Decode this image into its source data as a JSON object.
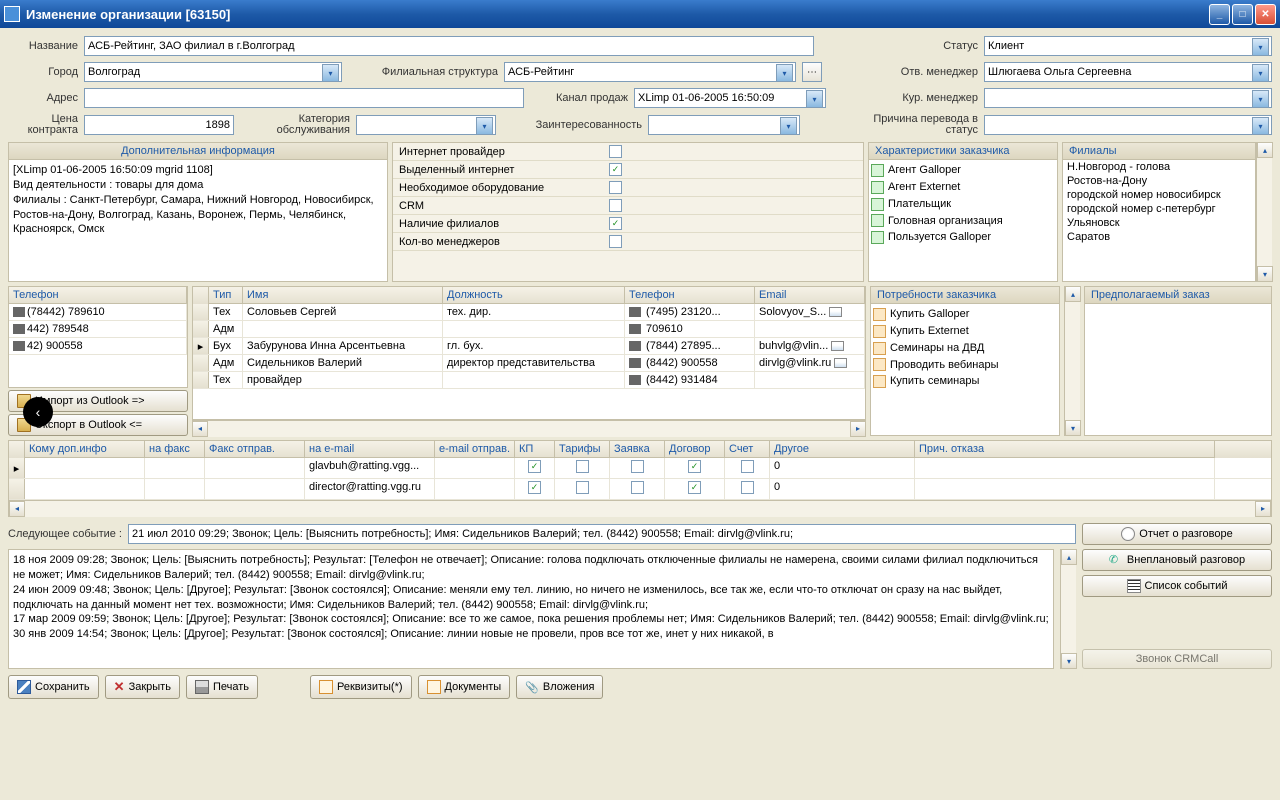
{
  "window": {
    "title": "Изменение организации [63150]"
  },
  "labels": {
    "name": "Название",
    "city": "Город",
    "branch_struct": "Филиальная структура",
    "status": "Статус",
    "resp_mgr": "Отв. менеджер",
    "address": "Адрес",
    "sales_channel": "Канал продаж",
    "cur_mgr": "Кур. менеджер",
    "contract_price": "Цена контракта",
    "service_cat": "Категория обслуживания",
    "interest": "Заинтересованность",
    "reason_status": "Причина перевода в статус"
  },
  "fields": {
    "name": "АСБ-Рейтинг, ЗАО филиал в г.Волгоград",
    "city": "Волгоград",
    "branch_struct": "АСБ-Рейтинг",
    "status": "Клиент",
    "resp_mgr": "Шлюгаева Ольга Сергеевна",
    "address": "",
    "sales_channel": "XLimp 01-06-2005 16:50:09",
    "cur_mgr": "",
    "contract_price": "1898",
    "service_cat": "",
    "interest": "",
    "reason_status": ""
  },
  "addinfo": {
    "head": "Дополнительная информация",
    "body": "[XLimp 01-06-2005 16:50:09 mgrid 1108]\nВид деятельности : товары для дома\nФилиалы : Санкт-Петербург, Самара, Нижний Новгород, Новосибирск, Ростов-на-Дону, Волгоград, Казань, Воронеж, Пермь, Челябинск, Красноярск, Омск"
  },
  "props": {
    "items": [
      {
        "label": "Интернет провайдер",
        "checked": false
      },
      {
        "label": "Выделенный интернет",
        "checked": true
      },
      {
        "label": "Необходимое оборудование",
        "checked": false
      },
      {
        "label": "CRM",
        "checked": false
      },
      {
        "label": "Наличие филиалов",
        "checked": true
      },
      {
        "label": "Кол-во менеджеров",
        "checked": false
      }
    ]
  },
  "char": {
    "head": "Характеристики заказчика",
    "items": [
      "Агент Galloper",
      "Агент Externet",
      "Плательщик",
      "Головная организация",
      "Пользуется Galloper"
    ]
  },
  "branches": {
    "head": "Филиалы",
    "items": [
      "Н.Новгород - голова",
      "Ростов-на-Дону",
      "городской номер новосибирск",
      "городской номер с-петербург",
      "Ульяновск",
      "Саратов"
    ]
  },
  "needs": {
    "head": "Потребности заказчика",
    "items": [
      "Купить Galloper",
      "Купить Externet",
      "Семинары на ДВД",
      "Проводить вебинары",
      "Купить семинары"
    ]
  },
  "proposed": {
    "head": "Предполагаемый заказ"
  },
  "phones": {
    "head": "Телефон",
    "items": [
      "(78442) 789610",
      "442) 789548",
      "42) 900558"
    ],
    "import_btn": "Импорт из Outlook =>",
    "export_btn": "Экспорт в Outlook <="
  },
  "contacts": {
    "cols": {
      "type": "Тип",
      "name": "Имя",
      "pos": "Должность",
      "tel": "Телефон",
      "email": "Email"
    },
    "rows": [
      {
        "type": "Тех",
        "name": "Соловьев Сергей",
        "pos": "тех. дир.",
        "tel": "(7495) 23120...",
        "email": "Solovyov_S..."
      },
      {
        "type": "Адм",
        "name": "",
        "pos": "",
        "tel": "709610",
        "email": ""
      },
      {
        "type": "Бух",
        "name": "Забурунова Инна Арсентьевна",
        "pos": "гл. бух.",
        "tel": "(7844) 27895...",
        "email": "buhvlg@vlin...",
        "current": true
      },
      {
        "type": "Адм",
        "name": "Сидельников Валерий",
        "pos": "директор представительства",
        "tel": "(8442) 900558",
        "email": "dirvlg@vlink.ru"
      },
      {
        "type": "Тех",
        "name": "провайдер",
        "pos": "",
        "tel": "(8442) 931484",
        "email": ""
      }
    ]
  },
  "docgrid": {
    "cols": [
      "Кому доп.инфо",
      "на факс",
      "Факс отправ.",
      "на e-mail",
      "e-mail отправ.",
      "КП",
      "Тарифы",
      "Заявка",
      "Договор",
      "Счет",
      "Другое",
      "Прич. отказа"
    ],
    "rows": [
      {
        "email": "glavbuh@ratting.vgg...",
        "kp": true,
        "dogovor": true,
        "other": "0"
      },
      {
        "email": "director@ratting.vgg.ru",
        "kp": true,
        "dogovor": true,
        "other": "0"
      }
    ]
  },
  "nextevent": {
    "label": "Следующее событие :",
    "text": "21 июл 2010 09:29; Звонок; Цель: [Выяснить потребность]; Имя: Сидельников Валерий; тел. (8442) 900558; Email: dirvlg@vlink.ru;",
    "report_btn": "Отчет о разговоре"
  },
  "history": "18 ноя 2009 09:28; Звонок; Цель: [Выяснить потребность]; Результат: [Телефон не отвечает]; Описание: голова подключать отключенные филиалы не намерена, своими силами филиал подключиться не может; Имя: Сидельников Валерий; тел. (8442) 900558; Email: dirvlg@vlink.ru;\n24 июн 2009 09:48; Звонок; Цель: [Другое]; Результат: [Звонок состоялся]; Описание: меняли ему тел. линию, но ничего не изменилось, все так же, если что-то отключат он сразу на нас выйдет, подключать на данный момент нет тех. возможности; Имя: Сидельников Валерий; тел. (8442) 900558; Email: dirvlg@vlink.ru;\n17 мар 2009 09:59; Звонок; Цель: [Другое]; Результат: [Звонок состоялся]; Описание: все то же самое, пока решения проблемы нет; Имя: Сидельников Валерий; тел. (8442) 900558; Email: dirvlg@vlink.ru;\n30 янв 2009 14:54; Звонок; Цель: [Другое]; Результат: [Звонок состоялся]; Описание: линии новые не провели, пров все тот же, инет у них никакой, в",
  "rightbtns": {
    "unplanned": "Внеплановый разговор",
    "eventlist": "Список событий",
    "crmcall": "Звонок CRMCall"
  },
  "toolbar": {
    "save": "Сохранить",
    "close": "Закрыть",
    "print": "Печать",
    "req": "Реквизиты(*)",
    "docs": "Документы",
    "attach": "Вложения"
  }
}
